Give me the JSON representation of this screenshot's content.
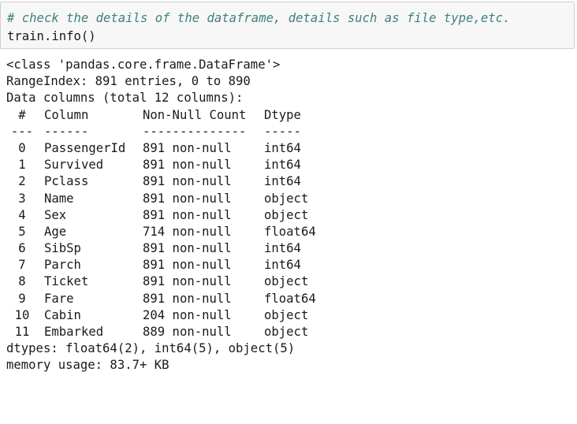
{
  "input": {
    "comment": "# check the details of the dataframe, details such as file type,etc.",
    "code": "train.info()"
  },
  "output": {
    "class_line": "<class 'pandas.core.frame.DataFrame'>",
    "range_index": "RangeIndex: 891 entries, 0 to 890",
    "data_columns": "Data columns (total 12 columns):",
    "header": {
      "idx": "#",
      "column": "Column",
      "count": "Non-Null Count",
      "dtype": "Dtype"
    },
    "separator": {
      "idx": "---",
      "column": "------",
      "count": "--------------",
      "dtype": "-----"
    },
    "rows": [
      {
        "idx": "0",
        "column": "PassengerId",
        "count": "891 non-null",
        "dtype": "int64"
      },
      {
        "idx": "1",
        "column": "Survived",
        "count": "891 non-null",
        "dtype": "int64"
      },
      {
        "idx": "2",
        "column": "Pclass",
        "count": "891 non-null",
        "dtype": "int64"
      },
      {
        "idx": "3",
        "column": "Name",
        "count": "891 non-null",
        "dtype": "object"
      },
      {
        "idx": "4",
        "column": "Sex",
        "count": "891 non-null",
        "dtype": "object"
      },
      {
        "idx": "5",
        "column": "Age",
        "count": "714 non-null",
        "dtype": "float64"
      },
      {
        "idx": "6",
        "column": "SibSp",
        "count": "891 non-null",
        "dtype": "int64"
      },
      {
        "idx": "7",
        "column": "Parch",
        "count": "891 non-null",
        "dtype": "int64"
      },
      {
        "idx": "8",
        "column": "Ticket",
        "count": "891 non-null",
        "dtype": "object"
      },
      {
        "idx": "9",
        "column": "Fare",
        "count": "891 non-null",
        "dtype": "float64"
      },
      {
        "idx": "10",
        "column": "Cabin",
        "count": "204 non-null",
        "dtype": "object"
      },
      {
        "idx": "11",
        "column": "Embarked",
        "count": "889 non-null",
        "dtype": "object"
      }
    ],
    "dtypes": "dtypes: float64(2), int64(5), object(5)",
    "memory": "memory usage: 83.7+ KB"
  }
}
